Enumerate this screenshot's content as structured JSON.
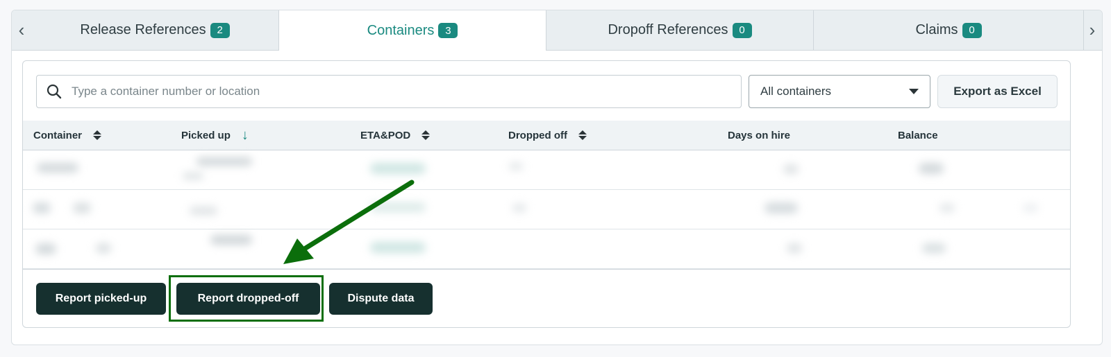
{
  "tabs": [
    {
      "label": "Release References",
      "count": "2"
    },
    {
      "label": "Containers",
      "count": "3"
    },
    {
      "label": "Dropoff References",
      "count": "0"
    },
    {
      "label": "Claims",
      "count": "0"
    }
  ],
  "search": {
    "placeholder": "Type a container number or location",
    "value": ""
  },
  "filter": {
    "selected": "All containers"
  },
  "export_label": "Export as Excel",
  "columns": {
    "container": "Container",
    "picked_up": "Picked up",
    "eta_pod": "ETA&POD",
    "dropped_off": "Dropped off",
    "days_on_hire": "Days on hire",
    "balance": "Balance"
  },
  "actions": {
    "report_picked_up": "Report picked-up",
    "report_dropped_off": "Report dropped-off",
    "dispute_data": "Dispute data"
  },
  "colors": {
    "accent": "#1a8a80",
    "dark_button": "#16302f",
    "annotation": "#0b6e0b"
  },
  "icons": {
    "search": "search-icon",
    "sort": "sort-icon",
    "sorted_desc": "arrow-down-icon",
    "dropdown": "caret-down-icon"
  }
}
